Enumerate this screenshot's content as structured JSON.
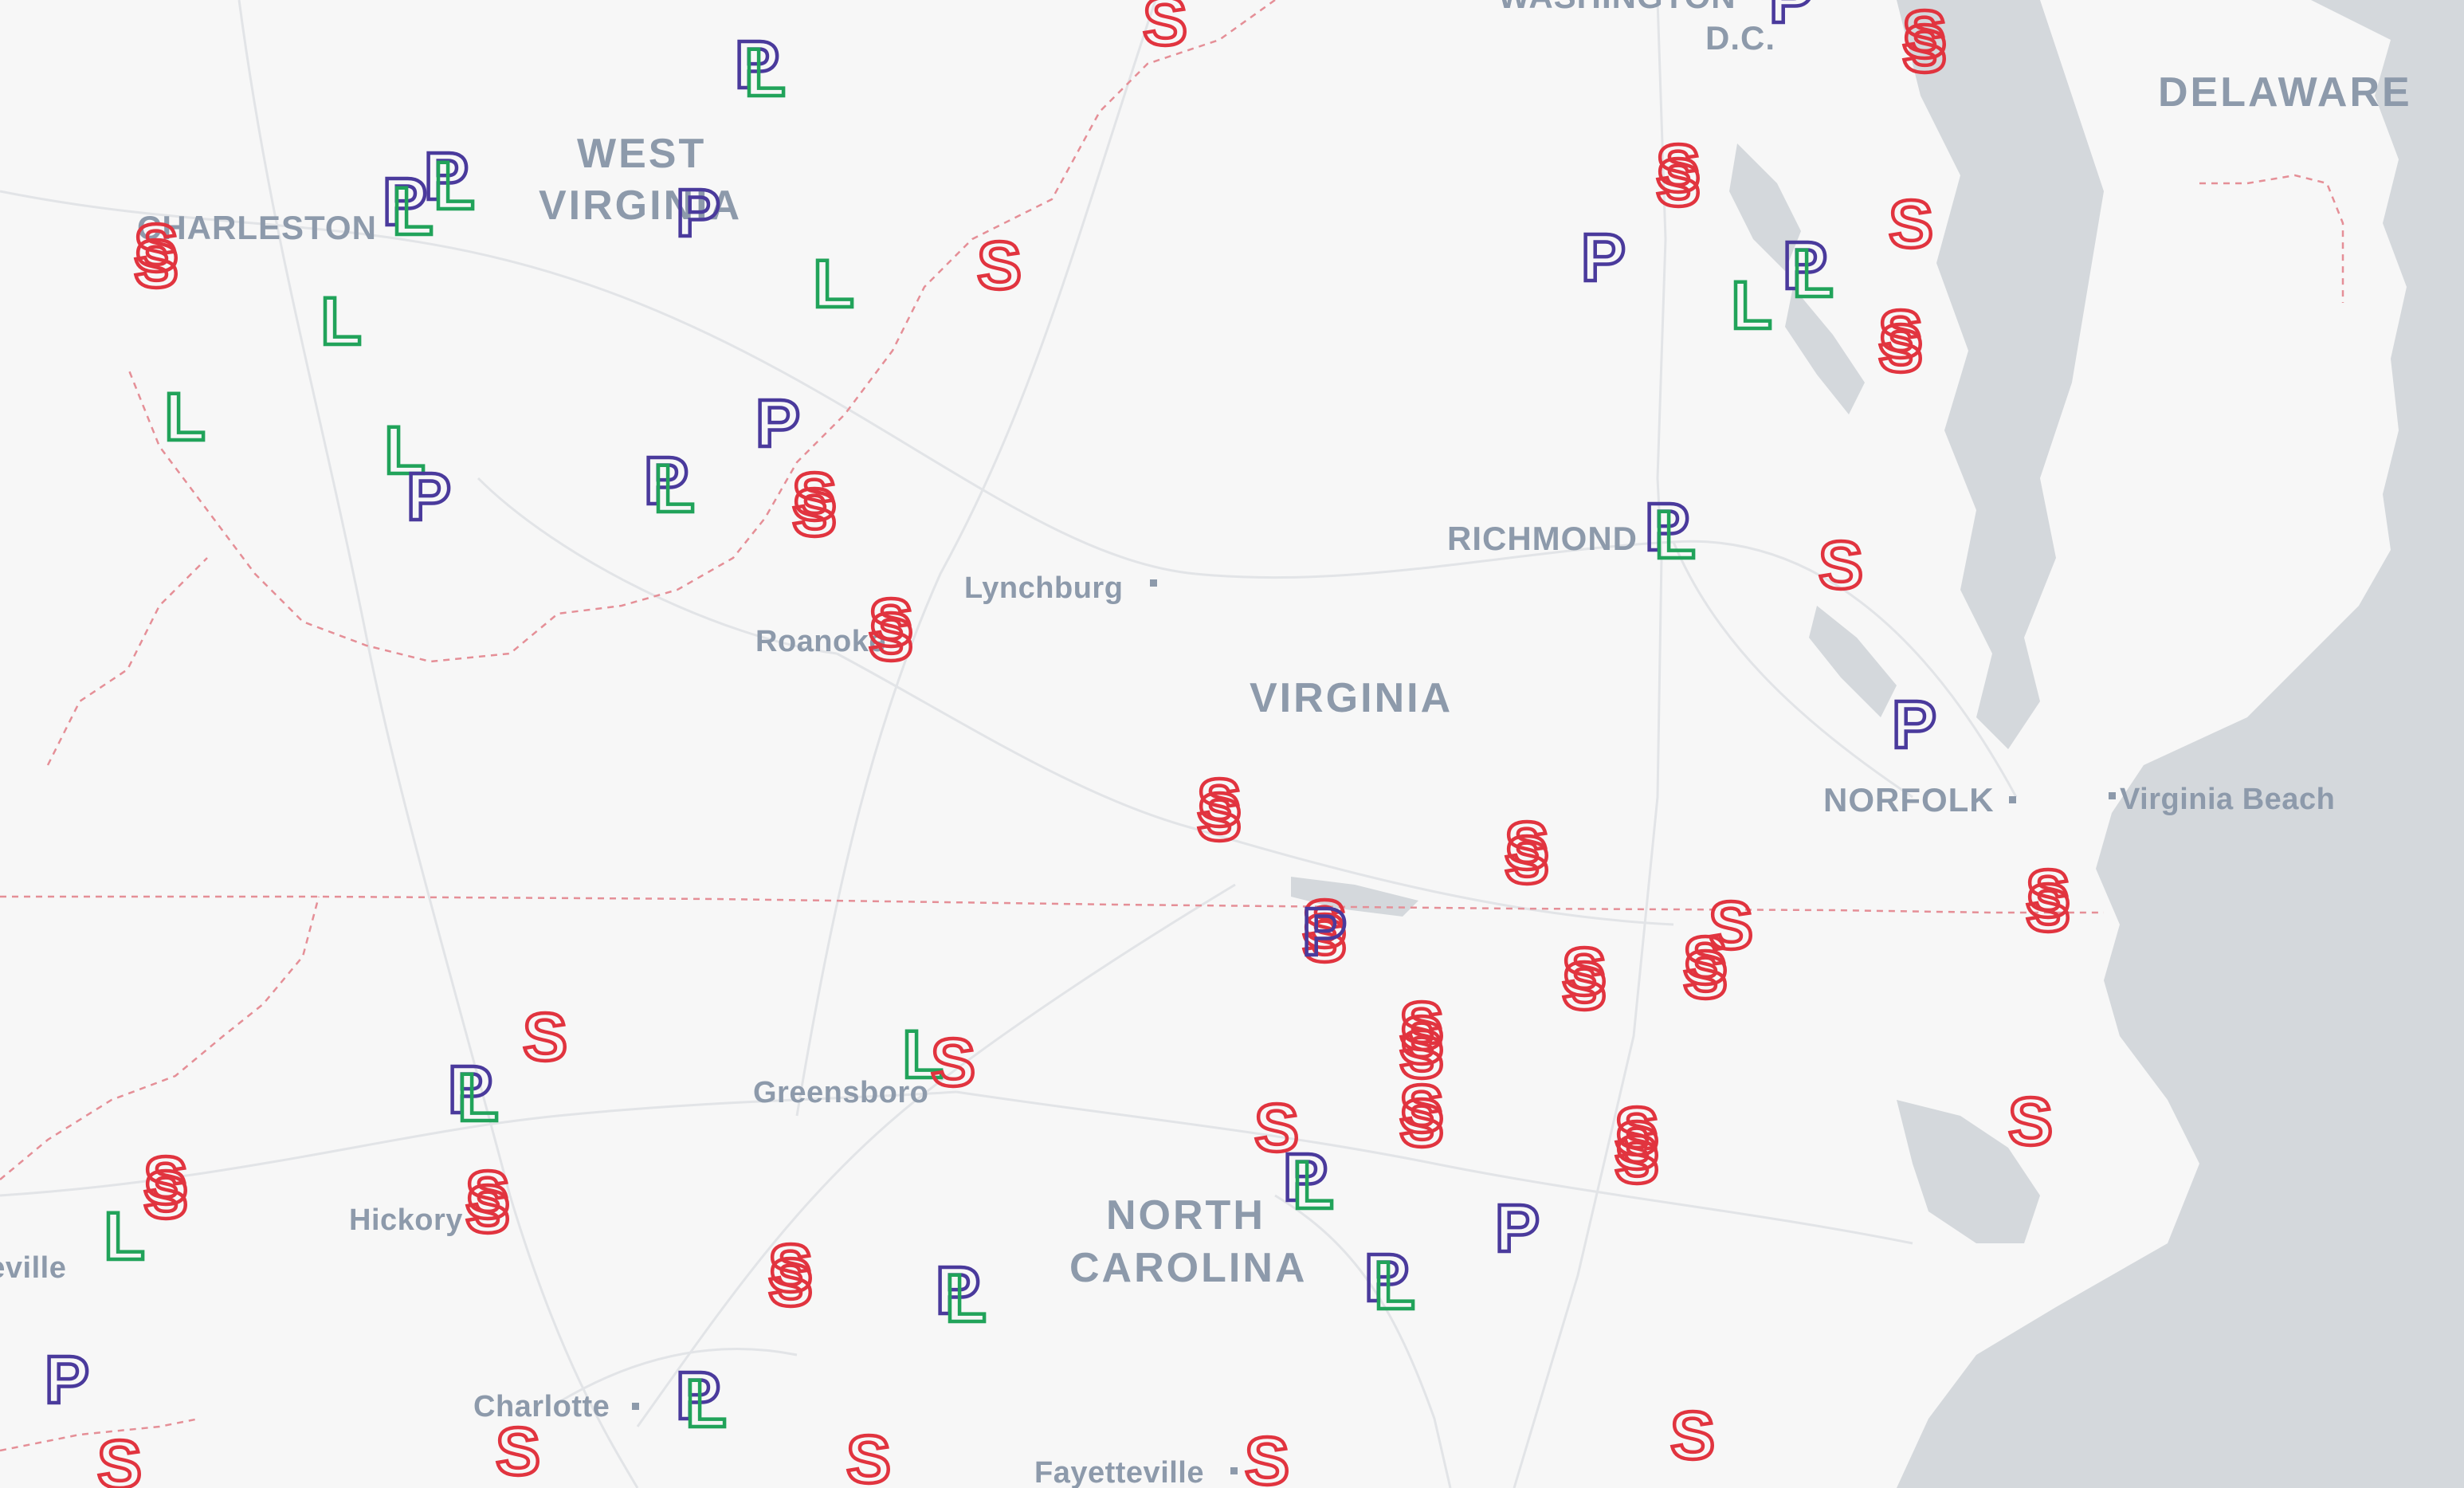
{
  "map": {
    "colors": {
      "land": "#f7f7f7",
      "water": "#d4d8dc",
      "border": "#e58f97",
      "road": "#e2e4e7",
      "label": "#8d9aab",
      "S": "#e1343f",
      "P": "#4a3a9c",
      "L": "#21a35a"
    },
    "labels": {
      "washington": "WASHINGTON",
      "dc": "D.C.",
      "delaware": "DELAWARE",
      "west_virginia_1": "WEST",
      "west_virginia_2": "VIRGINIA",
      "charleston": "CHARLESTON",
      "richmond": "RICHMOND",
      "lynchburg": "Lynchburg",
      "roanoke": "Roanoke",
      "virginia": "VIRGINIA",
      "norfolk": "NORFOLK",
      "virginia_beach": "Virginia Beach",
      "greensboro": "Greensboro",
      "hickory": "Hickory",
      "asheville": "Asheville",
      "north_carolina_1": "NORTH",
      "north_carolina_2": "CAROLINA",
      "charlotte": "Charlotte",
      "fayetteville": "Fayetteville"
    },
    "marker_types": {
      "S": "S",
      "P": "P",
      "L": "L"
    }
  }
}
